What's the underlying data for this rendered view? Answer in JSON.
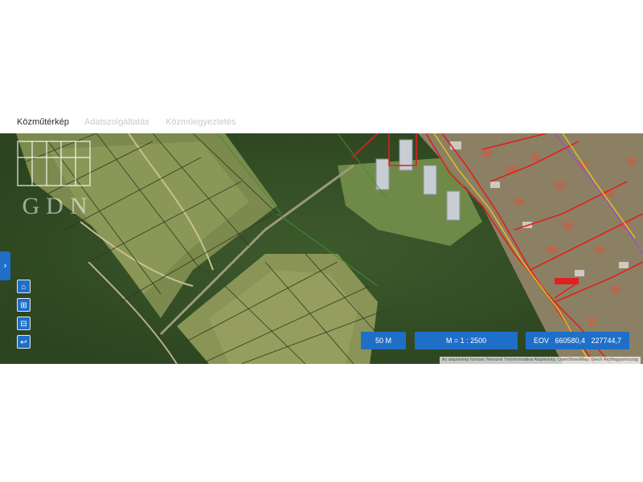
{
  "tabs": [
    {
      "label": "Közműtérkép",
      "active": true
    },
    {
      "label": "Adatszolgáltatás",
      "active": false
    },
    {
      "label": "Közműegyeztetés",
      "active": false
    }
  ],
  "map": {
    "controls": [
      {
        "name": "home-icon",
        "glyph": "⌂"
      },
      {
        "name": "zoom-in-icon",
        "glyph": "⊞"
      },
      {
        "name": "zoom-out-icon",
        "glyph": "⊟"
      },
      {
        "name": "back-icon",
        "glyph": "↩"
      }
    ],
    "sidebar_toggle_glyph": "›",
    "scale_bar": "50 M",
    "scale_ratio": "M = 1 : 2500",
    "coordinates": "EOV   660580,4   227744,7",
    "attribution": "Az alaptérkép forrása: Nemzeti Térinformatikai Alaptérkép, OpenStreetMap, GeoX ArcMagyarország",
    "watermark": "GDN",
    "colors": {
      "accent": "#1f6fc9",
      "utility_red": "#e0201f",
      "utility_yellow": "#e8c31a",
      "parcel_line": "#2c3a22"
    }
  }
}
